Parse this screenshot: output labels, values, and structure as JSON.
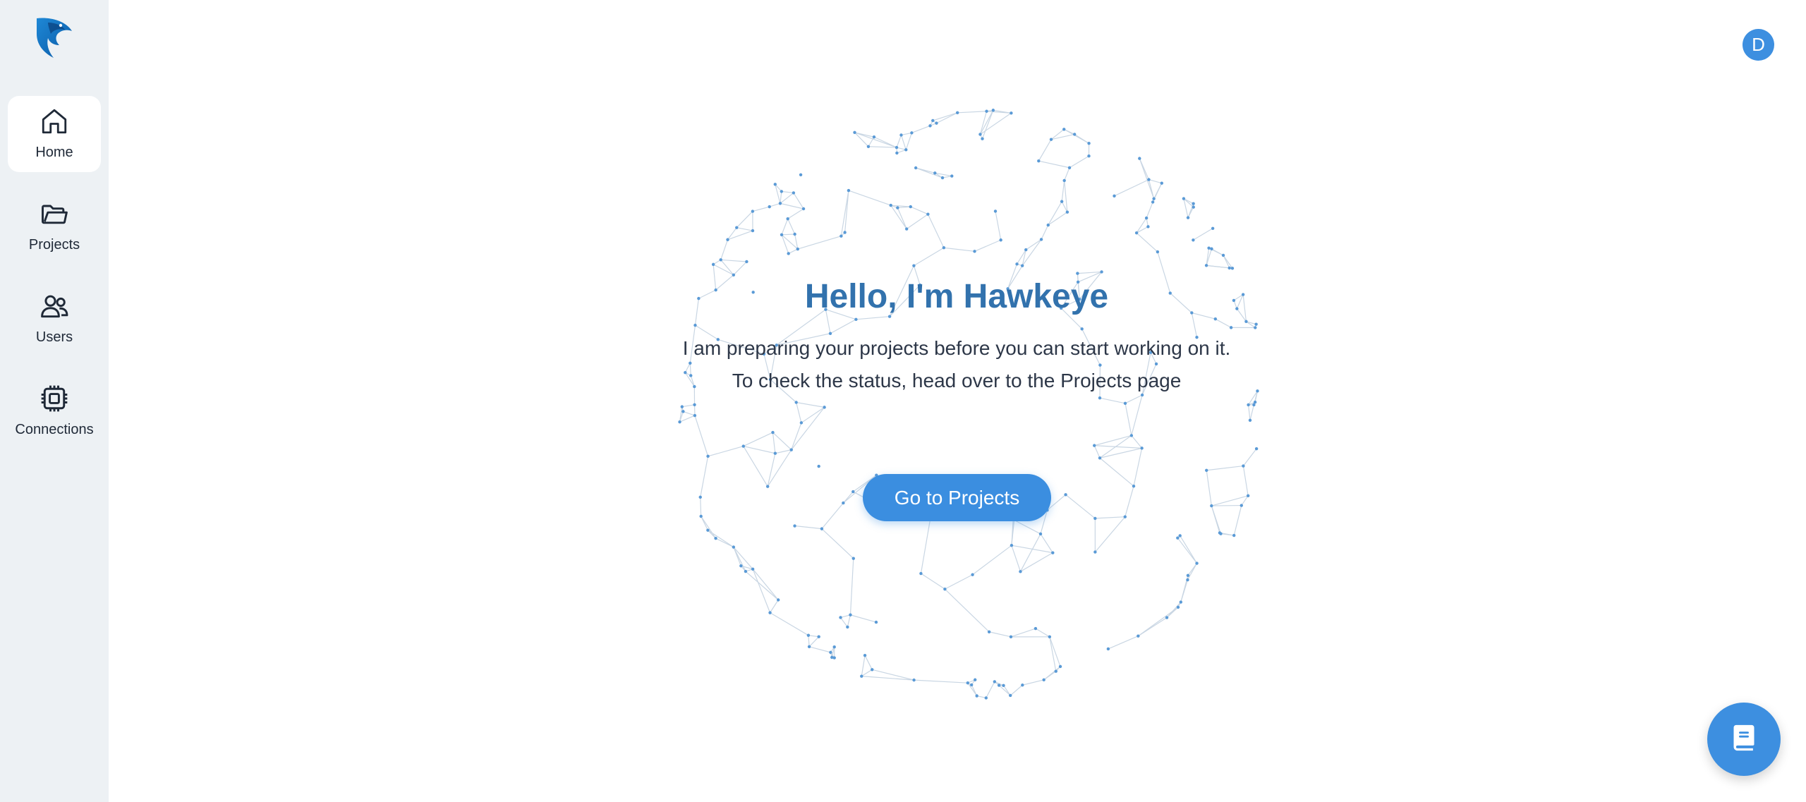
{
  "sidebar": {
    "items": [
      {
        "label": "Home",
        "icon": "home-icon",
        "active": true
      },
      {
        "label": "Projects",
        "icon": "folder-icon",
        "active": false
      },
      {
        "label": "Users",
        "icon": "users-icon",
        "active": false
      },
      {
        "label": "Connections",
        "icon": "chip-icon",
        "active": false
      }
    ]
  },
  "header": {
    "avatar_initial": "D"
  },
  "hero": {
    "title": "Hello, I'm Hawkeye",
    "line1": "I am preparing your projects before you can start working on it.",
    "line2": "To check the status, head over to the Projects page",
    "cta_label": "Go to Projects"
  },
  "fab": {
    "icon": "book-icon"
  },
  "colors": {
    "accent": "#3d8fe0",
    "title": "#3272ad",
    "sidebar_bg": "#edf1f4"
  }
}
